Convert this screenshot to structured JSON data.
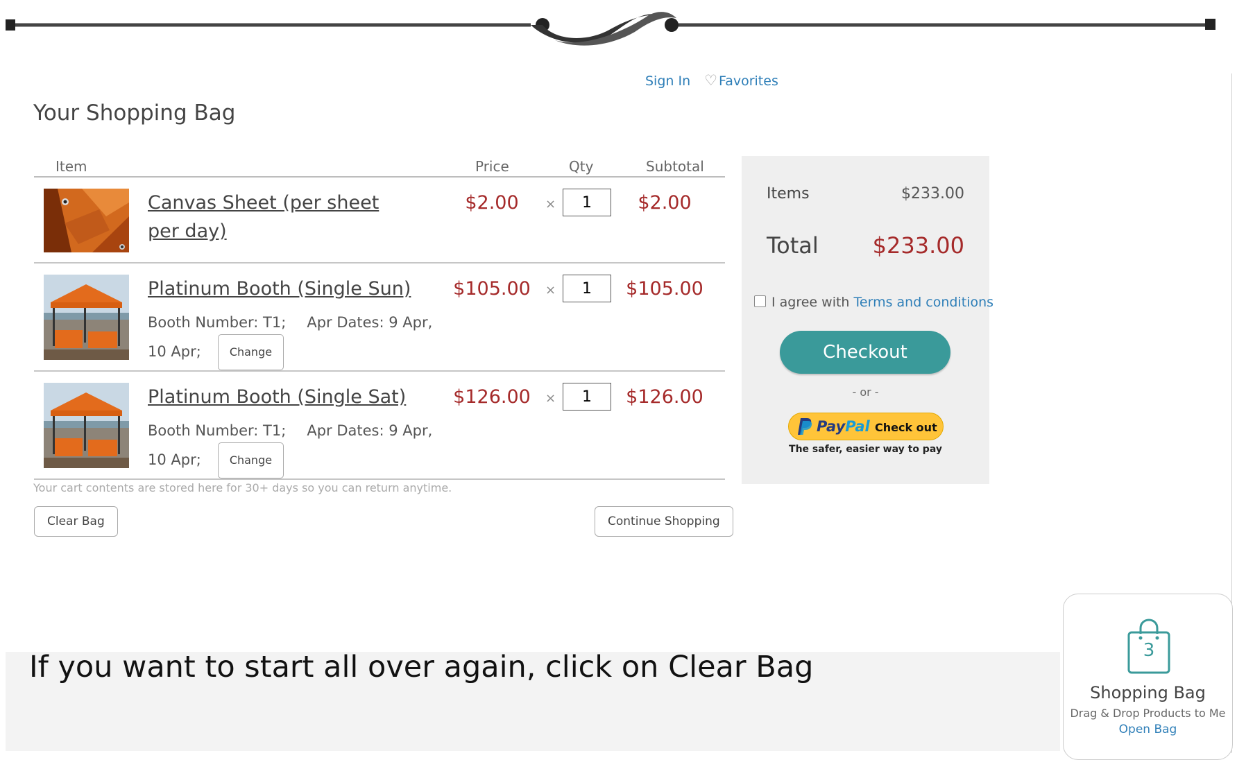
{
  "header": {
    "sign_in": "Sign In",
    "favorites": "Favorites",
    "heart_icon": "♡"
  },
  "page_title": "Your Shopping Bag",
  "cart": {
    "columns": {
      "item": "Item",
      "price": "Price",
      "qty": "Qty",
      "subtotal": "Subtotal"
    },
    "items": [
      {
        "name": "Canvas Sheet (per sheet per day)",
        "price": "$2.00",
        "qty": "1",
        "subtotal": "$2.00",
        "times": "×"
      },
      {
        "name": "Platinum Booth (Single Sun)",
        "price": "$105.00",
        "qty": "1",
        "subtotal": "$105.00",
        "times": "×",
        "meta_booth": "Booth Number: T1;",
        "meta_dates_a": "Apr Dates: 9 Apr,",
        "meta_dates_b": "10 Apr;",
        "change_label": "Change"
      },
      {
        "name": "Platinum Booth (Single Sat)",
        "price": "$126.00",
        "qty": "1",
        "subtotal": "$126.00",
        "times": "×",
        "meta_booth": "Booth Number: T1;",
        "meta_dates_a": "Apr Dates: 9 Apr,",
        "meta_dates_b": "10 Apr;",
        "change_label": "Change"
      }
    ],
    "storage_note": "Your cart contents are stored here for 30+ days so you can return anytime.",
    "clear_label": "Clear Bag",
    "continue_label": "Continue Shopping"
  },
  "summary": {
    "items_label": "Items",
    "items_value": "$233.00",
    "total_label": "Total",
    "total_value": "$233.00",
    "agree_text": "I agree with",
    "terms_link": "Terms and conditions",
    "checkout_label": "Checkout",
    "or_text": "- or -",
    "paypal_word_a": "Pay",
    "paypal_word_b": "Pal",
    "paypal_checkout": "Check out",
    "paypal_tagline": "The safer, easier way to pay"
  },
  "caption": "If you want to start all over again, click on Clear Bag",
  "bag_widget": {
    "count": "3",
    "title": "Shopping Bag",
    "subtitle": "Drag & Drop Products to Me",
    "open_label": "Open Bag"
  },
  "colors": {
    "accent_teal": "#3a9a9a",
    "price_red": "#a52a2a",
    "link_blue": "#2f7fb8",
    "paypal_yellow": "#ffc439",
    "tarp_orange": "#d2691e"
  }
}
